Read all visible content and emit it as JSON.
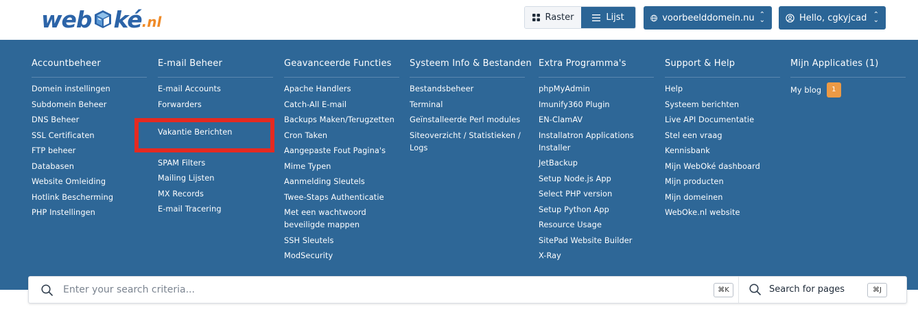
{
  "logo": {
    "part1": "web",
    "part2": "ké",
    "suffix": ".nl"
  },
  "view_toggle": {
    "raster_label": "Raster",
    "lijst_label": "Lijst"
  },
  "domain_select": {
    "label": "voorbeelddomein.nu"
  },
  "user_menu": {
    "label": "Hello, cgkyjcad"
  },
  "colors": {
    "panel": "#2e6797",
    "accent": "#2b6596",
    "badge": "#ec9a45",
    "highlight": "#e52a21"
  },
  "menu": {
    "columns": [
      {
        "title": "Accountbeheer",
        "items": [
          "Domein instellingen",
          "Subdomein Beheer",
          "DNS Beheer",
          "SSL Certificaten",
          "FTP beheer",
          "Databasen",
          "Website Omleiding",
          "Hotlink Bescherming",
          "PHP Instellingen"
        ]
      },
      {
        "title": "E-mail Beheer",
        "items": [
          "E-mail Accounts",
          "Forwarders",
          "Vakantie Berichten",
          "SPAM Filters",
          "Mailing Lijsten",
          "MX Records",
          "E-mail Tracering"
        ]
      },
      {
        "title": "Geavanceerde Functies",
        "items": [
          "Apache Handlers",
          "Catch-All E-mail",
          "Backups Maken/Terugzetten",
          "Cron Taken",
          "Aangepaste Fout Pagina's",
          "Mime Typen",
          "Aanmelding Sleutels",
          "Twee-Staps Authenticatie",
          "Met een wachtwoord beveiligde mappen",
          "SSH Sleutels",
          "ModSecurity"
        ]
      },
      {
        "title": "Systeem Info & Bestanden",
        "items": [
          "Bestandsbeheer",
          "Terminal",
          "Geïnstalleerde Perl modules",
          "Siteoverzicht / Statistieken / Logs"
        ]
      },
      {
        "title": "Extra Programma's",
        "items": [
          "phpMyAdmin",
          "Imunify360 Plugin",
          "EN-ClamAV",
          "Installatron Applications Installer",
          "JetBackup",
          "Setup Node.js App",
          "Select PHP version",
          "Setup Python App",
          "Resource Usage",
          "SitePad Website Builder",
          "X-Ray"
        ]
      },
      {
        "title": "Support & Help",
        "items": [
          "Help",
          "Systeem berichten",
          "Live API Documentatie",
          "Stel een vraag",
          "Kennisbank",
          "Mijn WebOké dashboard",
          "Mijn producten",
          "Mijn domeinen",
          "WebOke.nl website"
        ]
      },
      {
        "title": "Mijn Applicaties (1)",
        "items": [
          "My blog"
        ],
        "badge": "1"
      }
    ]
  },
  "search": {
    "placeholder": "Enter your search criteria...",
    "shortcut1": "⌘K",
    "pages_label": "Search for pages",
    "shortcut2": "⌘J"
  }
}
